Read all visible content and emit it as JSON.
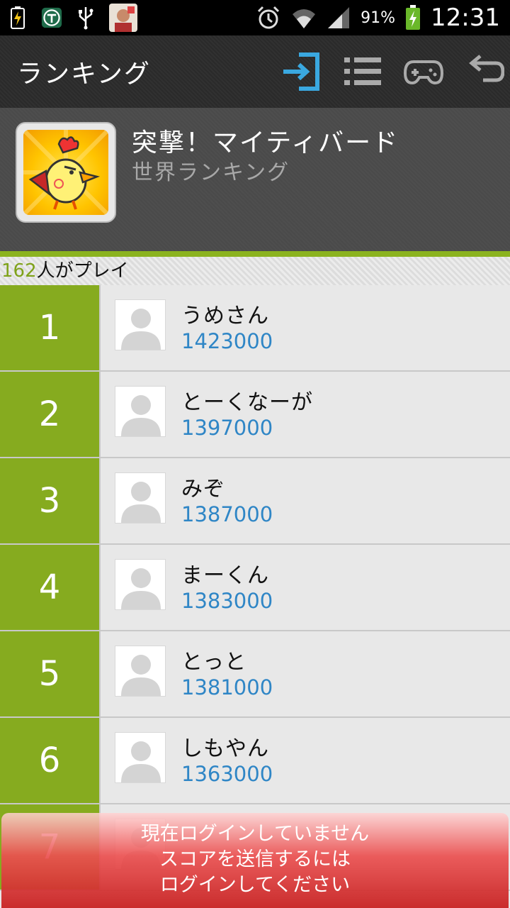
{
  "status_bar": {
    "battery_percent": "91%",
    "time": "12:31",
    "icons": [
      "charging-icon",
      "t-app-icon",
      "usb-icon",
      "app-avatar-icon",
      "alarm-icon",
      "wifi-icon",
      "signal-icon",
      "battery-icon"
    ]
  },
  "action_bar": {
    "title": "ランキング",
    "icons": [
      "login-icon",
      "list-icon",
      "gamepad-icon",
      "back-icon"
    ]
  },
  "game": {
    "title": "突撃！マイティバード",
    "subtitle": "世界ランキング"
  },
  "players": {
    "count": "162",
    "suffix": "人がプレイ"
  },
  "ranking": [
    {
      "rank": "1",
      "name": "うめさん",
      "score": "1423000"
    },
    {
      "rank": "2",
      "name": "とーくなーが",
      "score": "1397000"
    },
    {
      "rank": "3",
      "name": "みぞ",
      "score": "1387000"
    },
    {
      "rank": "4",
      "name": "まーくん",
      "score": "1383000"
    },
    {
      "rank": "5",
      "name": "とっと",
      "score": "1381000"
    },
    {
      "rank": "6",
      "name": "しもやん",
      "score": "1363000"
    },
    {
      "rank": "7",
      "name": "",
      "score": ""
    }
  ],
  "toast": {
    "line1": "現在ログインしていません",
    "line2": "スコアを送信するには",
    "line3": "ログインしてください"
  },
  "colors": {
    "accent_green": "#86ab1f",
    "score_blue": "#2f86c6",
    "login_icon_blue": "#3aa8e0",
    "toast_red": "#d83a3a"
  }
}
